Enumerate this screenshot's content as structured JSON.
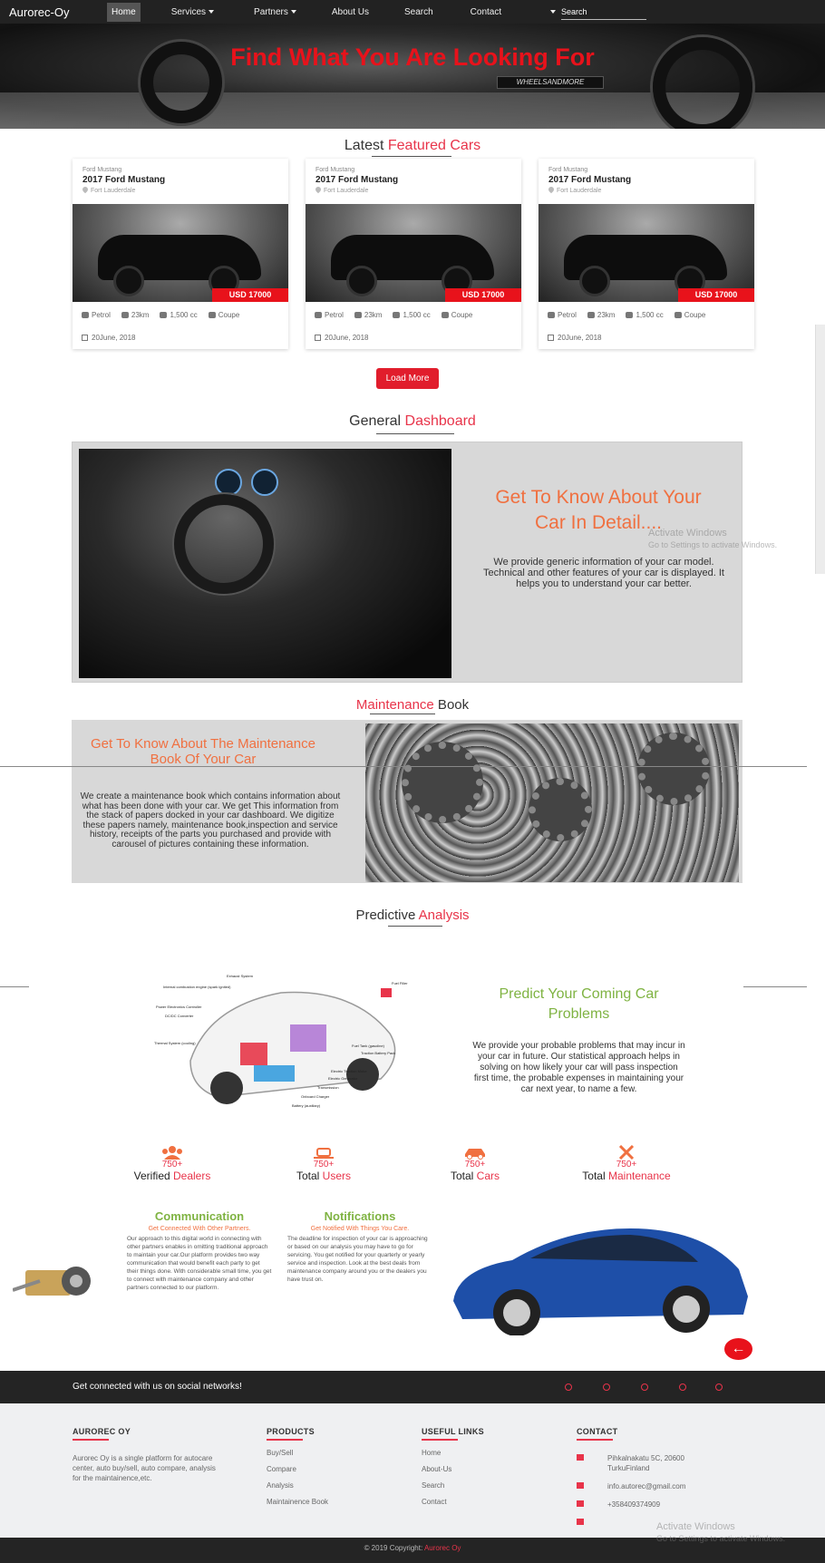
{
  "nav": {
    "brand": "Aurorec-Oy",
    "items": [
      {
        "label": "Home",
        "active": true,
        "dropdown": false
      },
      {
        "label": "Services",
        "active": false,
        "dropdown": true
      },
      {
        "label": "Partners",
        "active": false,
        "dropdown": true
      },
      {
        "label": "About Us",
        "active": false,
        "dropdown": false
      },
      {
        "label": "Search",
        "active": false,
        "dropdown": false
      },
      {
        "label": "Contact",
        "active": false,
        "dropdown": false
      }
    ],
    "search_placeholder": "Search"
  },
  "hero": {
    "title": "Find What You Are Looking For",
    "plate": "WHEELSANDMORE"
  },
  "featured": {
    "title_plain": "Latest ",
    "title_highlight": "Featured Cars",
    "cards": [
      {
        "model": "Ford Mustang",
        "name": "2017 Ford Mustang",
        "location": "Fort Lauderdale",
        "price": "USD 17000",
        "fuel": "Petrol",
        "mileage": "23km",
        "engine": "1,500 cc",
        "body": "Coupe",
        "date": "20June, 2018"
      },
      {
        "model": "Ford Mustang",
        "name": "2017 Ford Mustang",
        "location": "Fort Lauderdale",
        "price": "USD 17000",
        "fuel": "Petrol",
        "mileage": "23km",
        "engine": "1,500 cc",
        "body": "Coupe",
        "date": "20June, 2018"
      },
      {
        "model": "Ford Mustang",
        "name": "2017 Ford Mustang",
        "location": "Fort Lauderdale",
        "price": "USD 17000",
        "fuel": "Petrol",
        "mileage": "23km",
        "engine": "1,500 cc",
        "body": "Coupe",
        "date": "20June, 2018"
      }
    ],
    "load_more": "Load More"
  },
  "dashboard": {
    "title_plain": "General ",
    "title_highlight": "Dashboard",
    "heading": "Get To Know About Your Car In Detail....",
    "text": "We provide generic information of your car model. Technical and other features of your car is displayed. It helps you to understand your car better."
  },
  "maintenance": {
    "title_highlight": "Maintenance",
    "title_plain": " Book",
    "heading": "Get To Know About The Maintenance Book Of Your Car",
    "text": "We create a maintenance book which contains information about what has been done with your car. We get This information from the stack of papers docked in your car dashboard. We digitize these papers namely, maintenance book,inspection and service history, receipts of the parts you purchased and provide with carousel of pictures containing these information."
  },
  "predictive": {
    "title_plain": "Predictive ",
    "title_highlight": "Analysis",
    "heading": "Predict Your Coming Car Problems",
    "text": "We provide your probable problems that may incur in your car in future. Our statistical approach helps in solving on how likely your car will pass inspection first time, the probable expenses in maintaining your car next year, to name a few.",
    "diagram_labels": [
      "Exhaust System",
      "Internal combustion engine (spark ignited)",
      "Power Electronics Controller",
      "DC/DC Converter",
      "Thermal System (cooling)",
      "Fuel Filler",
      "Fuel Tank (gasoline)",
      "Traction Battery Pack",
      "Electric Traction Motor",
      "Electric Generator",
      "Transmission",
      "Onboard Charger",
      "Battery (auxiliary)"
    ]
  },
  "stats": [
    {
      "icon": "dealers-icon",
      "number": "750+",
      "label_plain": "Verified ",
      "label_highlight": "Dealers"
    },
    {
      "icon": "users-icon",
      "number": "750+",
      "label_plain": "Total ",
      "label_highlight": "Users"
    },
    {
      "icon": "car-icon",
      "number": "750+",
      "label_plain": "Total ",
      "label_highlight": "Cars"
    },
    {
      "icon": "wrench-icon",
      "number": "750+",
      "label_plain": "Total ",
      "label_highlight": "Maintenance"
    }
  ],
  "features": [
    {
      "title": "Communication",
      "subtitle": "Get Connected With Other Partners.",
      "text": "Our approach to this digital world in connecting with other partners enables in omitting traditional approach to maintain your car.Our platform provides two way communication that would benefit each party to get their things done. With considerable small time, you get to connect with maintenance company and other partners connected to our platform."
    },
    {
      "title": "Notifications",
      "subtitle": "Get Notified With Things You Care.",
      "text": "The deadline for inspection of your car is approaching or based on our analysis you may have to go for servicing. You get notified for your quarterly or yearly service and inspection. Look at the best deals from maintenance company around you or the dealers you have trust on."
    }
  ],
  "social": {
    "text": "Get connected with us on social networks!",
    "icons": [
      "facebook-icon",
      "twitter-icon",
      "google-plus-icon",
      "linkedin-icon",
      "instagram-icon"
    ]
  },
  "footer": {
    "about_title": "AUROREC OY",
    "about_text": "Aurorec Oy is a single platform for autocare center, auto buy/sell, auto compare, analysis for the maintainence,etc.",
    "products_title": "PRODUCTS",
    "products": [
      "Buy/Sell",
      "Compare",
      "Analysis",
      "Maintainence Book"
    ],
    "links_title": "USEFUL LINKS",
    "links": [
      "Home",
      "About-Us",
      "Search",
      "Contact"
    ],
    "contact_title": "CONTACT",
    "address": "Pihkalnakatu 5C, 20600 TurkuFinland",
    "email": "info.autorec@gmail.com",
    "phone": "+358409374909",
    "copyright_plain": "© 2019 Copyright: ",
    "copyright_highlight": "Aurorec Oy"
  },
  "watermark": {
    "line1": "Activate Windows",
    "line2": "Go to Settings to activate Windows."
  },
  "colors": {
    "accent": "#e8344a",
    "hero_title": "#e8121b",
    "orange_heading": "#f07040",
    "green_heading": "#7fb342",
    "navbar": "#222222"
  }
}
